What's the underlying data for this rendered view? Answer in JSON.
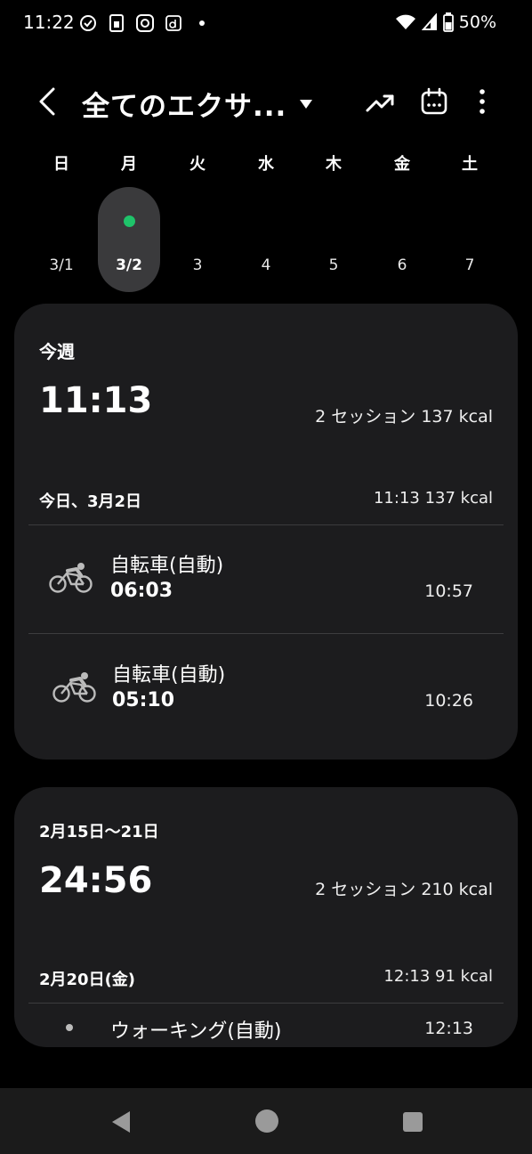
{
  "status": {
    "time": "11:22",
    "battery": "50%"
  },
  "app_bar": {
    "title": "全てのエクサ...",
    "icons": [
      "back-icon",
      "chevron-down-icon",
      "trending-up-icon",
      "calendar-icon",
      "more-vert-icon"
    ]
  },
  "week": {
    "days": [
      {
        "name": "日",
        "date": "3/1"
      },
      {
        "name": "月",
        "date": "3/2"
      },
      {
        "name": "火",
        "date": "3"
      },
      {
        "name": "水",
        "date": "4"
      },
      {
        "name": "木",
        "date": "5"
      },
      {
        "name": "金",
        "date": "6"
      },
      {
        "name": "土",
        "date": "7"
      }
    ]
  },
  "cards": [
    {
      "title": "今週",
      "total": "11:13",
      "summary": "2 セッション 137 kcal",
      "day_label": "今日、3月2日",
      "day_summary": "11:13  137 kcal",
      "sessions": [
        {
          "name": "自転車(自動)",
          "duration": "06:03",
          "time": "10:57"
        },
        {
          "name": "自転車(自動)",
          "duration": "05:10",
          "time": "10:26"
        }
      ]
    },
    {
      "title": "2月15日～21日",
      "total": "24:56",
      "summary": "2 セッション 210 kcal",
      "day_label": "2月20日(金)",
      "day_summary": "12:13  91 kcal",
      "sessions": [
        {
          "name": "ウォーキング(自動)",
          "time": "12:13"
        }
      ]
    }
  ],
  "colors": {
    "accent_dot": "#1fc36a",
    "card_bg": "#1c1c1e",
    "selected_pill": "#3a3a3c"
  }
}
